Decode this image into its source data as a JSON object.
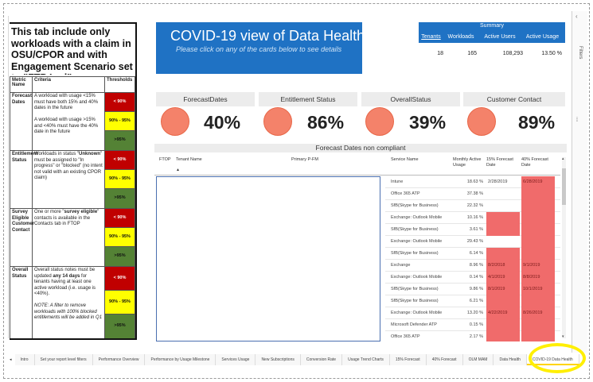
{
  "left_panel": {
    "heading": "This tab include only workloads with a claim in OSU/CPOR and with Engagement Scenario set to \"FTP Led\"",
    "columns": [
      "Metric Name",
      "Criteria",
      "Thresholds"
    ],
    "rows": [
      {
        "metric": "Forecast Dates",
        "criteria": "A workload with usage <15% must have both 15% and 40% dates in the future\n\nA workload with usage >15% and <40% must have the 40% date in the future",
        "thresholds": [
          "< 90%",
          "90% - 95%",
          ">95%"
        ]
      },
      {
        "metric": "Entitlement Status",
        "criteria": "Workloads in status \"Unknown\" must be assigned to \"In progress\" or \"blocked\" (no intent not valid with an existing CPOR claim)",
        "thresholds": [
          "< 90%",
          "90% - 95%",
          ">95%"
        ]
      },
      {
        "metric": "Survey Eligible Customer Contact",
        "criteria": "One or more \"survey eligible\" contacts is available in the Contacts tab in FTOP",
        "thresholds": [
          "< 90%",
          "90% - 95%",
          ">95%"
        ]
      },
      {
        "metric": "Overall Status",
        "criteria": "Overall status notes must be updated any 14 days for tenants having at least one active workload (i.e. usage is <40%).\n\nNOTE: A filter to remove workloads with 100% blocked entitlements will be added in Q1",
        "thresholds": [
          "< 90%",
          "90% - 95%",
          ">95%"
        ]
      }
    ]
  },
  "title_box": {
    "title": "COVID-19 view of Data Health",
    "subtitle": "Please click on any of the cards below to see details"
  },
  "summary": {
    "title": "Summary",
    "columns": [
      "Tenants",
      "Workloads",
      "Active Users",
      "Active Usage"
    ],
    "values": [
      "18",
      "165",
      "108,293",
      "13.50 %"
    ]
  },
  "cards": [
    {
      "title": "ForecastDates",
      "value": "40%"
    },
    {
      "title": "Entitlement Status",
      "value": "86%"
    },
    {
      "title": "OverallStatus",
      "value": "39%"
    },
    {
      "title": "Customer Contact",
      "value": "89%"
    }
  ],
  "table": {
    "title": "Forecast Dates non compliant",
    "columns": [
      "FTOP",
      "Tenant Name",
      "Primary P-FM",
      "Service Name",
      "Monthly Active Usage",
      "15% Forecast Date",
      "40% Forecast Date"
    ],
    "sort_indicator": "▲",
    "rows": [
      {
        "service": "Intune",
        "usage": "18.63 %",
        "d15": "2/28/2019",
        "d40": "6/28/2019",
        "d15_red": false,
        "d40_red": true
      },
      {
        "service": "Office 365 ATP",
        "usage": "37.38 %",
        "d15": "",
        "d40": "",
        "d15_red": false,
        "d40_red": true
      },
      {
        "service": "SfB(Skype for Business)",
        "usage": "22.32 %",
        "d15": "",
        "d40": "",
        "d15_red": false,
        "d40_red": true
      },
      {
        "service": "Exchange: Outlook Mobile",
        "usage": "10.16 %",
        "d15": "",
        "d40": "",
        "d15_red": true,
        "d40_red": true
      },
      {
        "service": "SfB(Skype for Business)",
        "usage": "3.61 %",
        "d15": "",
        "d40": "",
        "d15_red": true,
        "d40_red": true
      },
      {
        "service": "Exchange: Outlook Mobile",
        "usage": "29.43 %",
        "d15": "",
        "d40": "",
        "d15_red": false,
        "d40_red": true
      },
      {
        "service": "SfB(Skype for Business)",
        "usage": "6.14 %",
        "d15": "",
        "d40": "",
        "d15_red": true,
        "d40_red": true
      },
      {
        "service": "Exchange",
        "usage": "8.96 %",
        "d15": "8/2/2018",
        "d40": "9/1/2019",
        "d15_red": true,
        "d40_red": true
      },
      {
        "service": "Exchange: Outlook Mobile",
        "usage": "0.14 %",
        "d15": "4/1/2019",
        "d40": "8/8/2019",
        "d15_red": true,
        "d40_red": true
      },
      {
        "service": "SfB(Skype for Business)",
        "usage": "9.86 %",
        "d15": "8/1/2019",
        "d40": "10/1/2019",
        "d15_red": true,
        "d40_red": true
      },
      {
        "service": "SfB(Skype for Business)",
        "usage": "6.21 %",
        "d15": "",
        "d40": "",
        "d15_red": true,
        "d40_red": true
      },
      {
        "service": "Exchange: Outlook Mobile",
        "usage": "13.20 %",
        "d15": "4/22/2019",
        "d40": "8/26/2019",
        "d15_red": true,
        "d40_red": true
      },
      {
        "service": "Microsoft Defender ATP",
        "usage": "0.15 %",
        "d15": "",
        "d40": "",
        "d15_red": true,
        "d40_red": true
      },
      {
        "service": "Office 365 ATP",
        "usage": "2.17 %",
        "d15": "",
        "d40": "",
        "d15_red": true,
        "d40_red": true
      }
    ]
  },
  "filters_pane": {
    "label": "Filters",
    "collapse_glyph": "‹"
  },
  "tabs": {
    "nav_left": "◂",
    "nav_right": "▸",
    "items": [
      "Intro",
      "Set your report level filters",
      "Performance Overview",
      "Performance by Usage Milestone",
      "Services Usage",
      "New Subscriptions",
      "Conversion Rate",
      "Usage Trend Charts",
      "15% Forecast",
      "40% Forecast",
      "OLM MAM",
      "Data Health",
      "COVID-19 Data Health"
    ],
    "active": "COVID-19 Data Health"
  },
  "colors": {
    "title_blue": "#1f72c4",
    "threshold_red": "#c00000",
    "threshold_yellow": "#ffff00",
    "threshold_green": "#548235",
    "card_circle": "#f4826a",
    "cell_red": "#f06b6b",
    "highlight": "#ffef00"
  }
}
